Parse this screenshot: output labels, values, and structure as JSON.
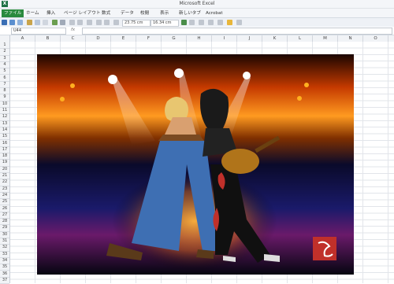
{
  "window": {
    "title": "Microsoft Excel",
    "app_icon": "excel-icon"
  },
  "ribbon": {
    "tabs": [
      "ファイル",
      "ホーム",
      "挿入",
      "ページ レイアウト",
      "数式",
      "データ",
      "校閲",
      "表示",
      "新しいタブ",
      "Acrobat"
    ]
  },
  "toolbar": {
    "width_value": "23.75 cm",
    "height_value": "16.34 cm"
  },
  "formula_bar": {
    "name_box": "U44",
    "fx_label": "fx",
    "value": ""
  },
  "grid": {
    "columns": [
      "A",
      "B",
      "C",
      "D",
      "E",
      "F",
      "G",
      "H",
      "I",
      "J",
      "K",
      "L",
      "M",
      "N",
      "O"
    ],
    "rows": [
      "1",
      "2",
      "3",
      "4",
      "5",
      "6",
      "7",
      "8",
      "9",
      "10",
      "11",
      "12",
      "13",
      "14",
      "15",
      "16",
      "17",
      "18",
      "19",
      "20",
      "21",
      "22",
      "23",
      "24",
      "25",
      "26",
      "27",
      "28",
      "29",
      "30",
      "31",
      "32",
      "33",
      "34",
      "35",
      "36",
      "37"
    ]
  },
  "artwork": {
    "description_icon": "rock-concert-illustration",
    "seal_icon": "red-artist-seal",
    "accent_colors": [
      "#ff9a20",
      "#2040c0",
      "#c0302a"
    ]
  }
}
